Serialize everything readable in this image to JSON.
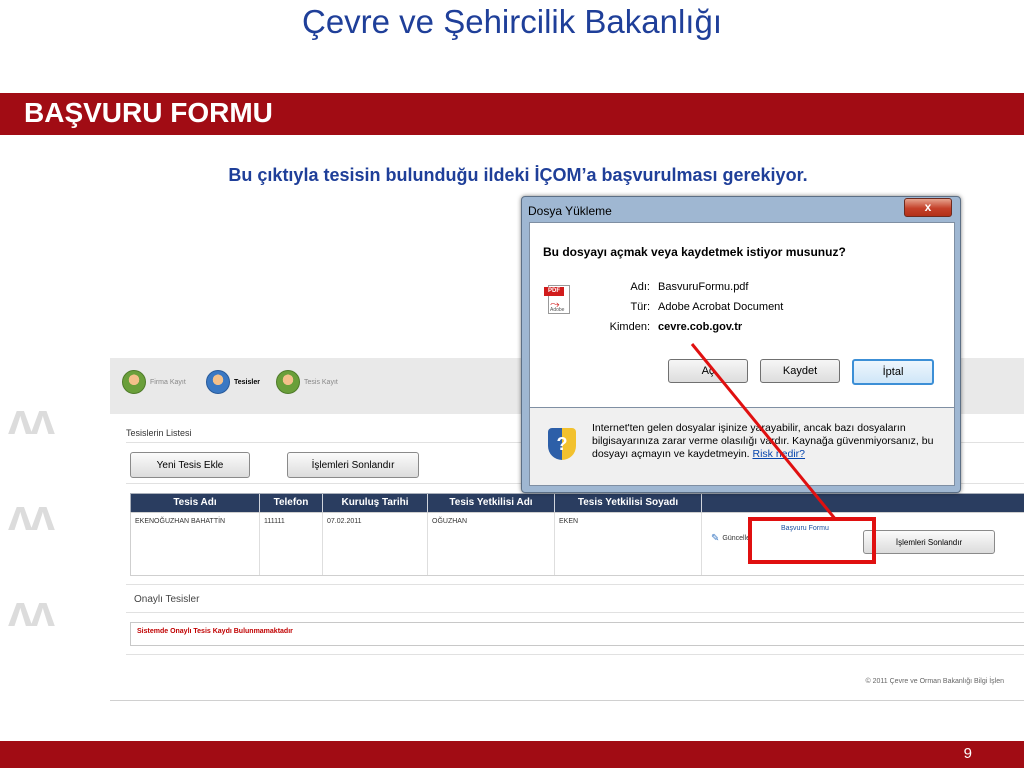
{
  "slide": {
    "title": "Çevre ve Şehircilik Bakanlığı",
    "section_title": "BAŞVURU FORMU",
    "instruction": "Bu çıktıyla tesisin bulunduğu ildeki İÇOM’a başvurulması gerekiyor.",
    "page_number": "9",
    "decoration_glyph": "ʌʌ",
    "brand_color": "#a10c14",
    "title_color": "#1f3f99"
  },
  "app": {
    "nav": [
      {
        "label": "Firma Kayıt",
        "icon": "user-icon",
        "active": false
      },
      {
        "label": "Tesisler",
        "icon": "user-icon",
        "active": true
      },
      {
        "label": "Tesis Kayıt",
        "icon": "user-icon",
        "active": false
      }
    ],
    "list_title": "Tesislerin Listesi",
    "buttons": {
      "new_facility": "Yeni Tesis Ekle",
      "complete_ops_top": "İşlemleri Sonlandır"
    },
    "table": {
      "headers": [
        "Tesis Adı",
        "Telefon",
        "Kuruluş Tarihi",
        "Tesis Yetkilisi Adı",
        "Tesis Yetkilisi Soyadı"
      ],
      "rows": [
        [
          "EKENOĞUZHAN BAHATTİN",
          "111111",
          "07.02.2011",
          "OĞUZHAN",
          "EKEN"
        ]
      ],
      "actions": {
        "update": "Güncelle",
        "application_form": "Başvuru Formu",
        "complete_ops": "İşlemleri Sonlandır"
      }
    },
    "approved_title": "Onaylı Tesisler",
    "approved_empty": "Sistemde Onaylı Tesis Kaydı Bulunmamaktadır",
    "footer": "© 2011 Çevre ve Orman Bakanlığı Bilgi İşlen"
  },
  "dialog": {
    "title": "Dosya Yükleme",
    "close": "x",
    "question": "Bu dosyayı açmak veya kaydetmek istiyor musunuz?",
    "file_icon_badge": "PDF",
    "file_icon_sub": "Adobe",
    "fields": [
      {
        "label": "Adı:",
        "value": "BasvuruFormu.pdf"
      },
      {
        "label": "Tür:",
        "value": "Adobe Acrobat Document"
      },
      {
        "label": "Kimden:",
        "value": "cevre.cob.gov.tr"
      }
    ],
    "buttons": {
      "open": "Aç",
      "save": "Kaydet",
      "cancel": "İptal"
    },
    "warning": "Internet'ten gelen dosyalar işinize yarayabilir, ancak bazı dosyaların bilgisayarınıza zarar verme olasılığı vardır. Kaynağa güvenmiyorsanız, bu dosyayı açmayın ve kaydetmeyin.",
    "warning_link": "Risk nedir?",
    "shield_glyph": "?"
  },
  "annotation_color": "#e01010"
}
